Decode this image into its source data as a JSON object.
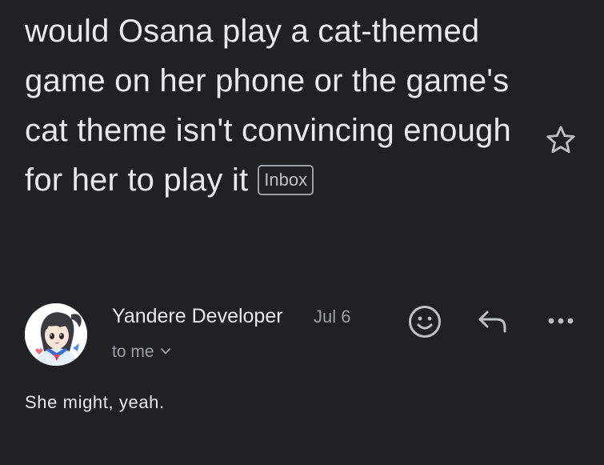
{
  "email": {
    "subject": "would Osana play a cat-themed game on her phone or the game's cat theme isn't convincing enough for her to play it",
    "label_chip": "Inbox",
    "starred": false,
    "sender_name": "Yandere Developer",
    "date": "Jul 6",
    "recipient_text": "to me",
    "body": "She might, yeah."
  },
  "icons": {
    "star": "star-outline-icon",
    "emoji": "smiley-face-icon",
    "reply": "reply-arrow-icon",
    "more": "more-horizontal-icon",
    "recipient_expand": "chevron-down-icon"
  },
  "colors": {
    "background": "#202124",
    "primary_text": "#e8eaed",
    "secondary_text": "#9aa0a6",
    "icon": "#bdc1c6"
  }
}
